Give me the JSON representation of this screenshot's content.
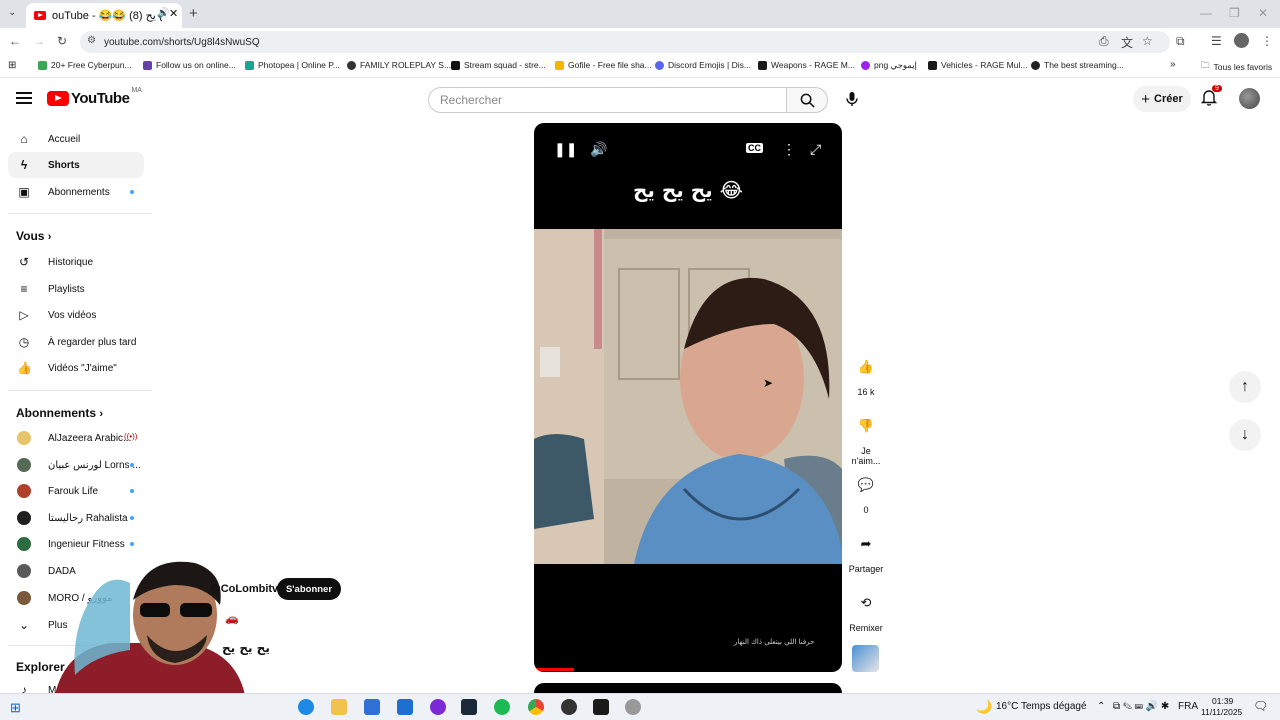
{
  "browser": {
    "tab_title": "ᴏuTube - 😂😂 يح يح يح (8)",
    "url": "youtube.com/shorts/Ug8l4sNwuSQ",
    "bookmarks": [
      {
        "label": "20+ Free Cyberpun...",
        "color": "#3aa757"
      },
      {
        "label": "Follow us on online...",
        "color": "#6441a5"
      },
      {
        "label": "Photopea | Online P...",
        "color": "#18a497"
      },
      {
        "label": "FAMILY ROLEPLAY S...",
        "color": "#333333"
      },
      {
        "label": "Stream squad - stre...",
        "color": "#111111"
      },
      {
        "label": "Gofile - Free file sha...",
        "color": "#f4b400"
      },
      {
        "label": "Discord Emojis | Dis...",
        "color": "#5865f2"
      },
      {
        "label": "Weapons - RAGE M...",
        "color": "#1a1a1a"
      },
      {
        "label": "png إيموجي",
        "color": "#a020f0"
      },
      {
        "label": "Vehicles - RAGE Mul...",
        "color": "#1a1a1a"
      },
      {
        "label": "The best streaming...",
        "color": "#222222"
      }
    ],
    "all_bookmarks": "Tous les favoris"
  },
  "header": {
    "logo_text": "YouTube",
    "country_code": "MA",
    "search_placeholder": "Rechercher",
    "create_label": "Créer",
    "notification_count": "9"
  },
  "sidebar": {
    "main": [
      {
        "label": "Accueil",
        "icon": "home-icon"
      },
      {
        "label": "Shorts",
        "icon": "shorts-icon"
      },
      {
        "label": "Abonnements",
        "icon": "subscriptions-icon"
      }
    ],
    "you_heading": "Vous",
    "you": [
      {
        "label": "Historique",
        "icon": "history-icon"
      },
      {
        "label": "Playlists",
        "icon": "playlists-icon"
      },
      {
        "label": "Vos vidéos",
        "icon": "your-videos-icon"
      },
      {
        "label": "À regarder plus tard",
        "icon": "watch-later-icon"
      },
      {
        "label": "Vidéos \"J'aime\"",
        "icon": "liked-icon"
      }
    ],
    "subs_heading": "Abonnements",
    "subs": [
      {
        "label": "AlJazeera Arabic...",
        "color": "#d9a441"
      },
      {
        "label": "لورنس عبيان Lorns ...",
        "color": "#556b55"
      },
      {
        "label": "Farouk Life",
        "color": "#b0402c"
      },
      {
        "label": "رحاليستا Rahalista",
        "color": "#1f1f1f"
      },
      {
        "label": "Ingenieur Fitness",
        "color": "#2d6b40"
      },
      {
        "label": "DADA",
        "color": "#5a5a5a"
      },
      {
        "label": "MORO / موورو",
        "color": "#7a5a3a"
      }
    ],
    "more_label": "Plus",
    "explore_heading": "Explorer",
    "explore_first": "Mu"
  },
  "short": {
    "overlay_title": "يح يح يح 😂",
    "subtitle_text": "حرفنا اللي بيتعلى ذاك النهار",
    "channel": "@CoLombitv",
    "subscribe_label": "S'abonner",
    "title": "يح يح يح",
    "progress_fraction": 0.13
  },
  "actions": {
    "likes": "16 k",
    "dislike_label": "Je n'aim...",
    "comments": "0",
    "share_label": "Partager",
    "remix_label": "Remixer"
  },
  "taskbar": {
    "weather": "16°C  Temps dégagé",
    "lang": "FRA",
    "time": "01:39",
    "date": "11/11/2025"
  }
}
